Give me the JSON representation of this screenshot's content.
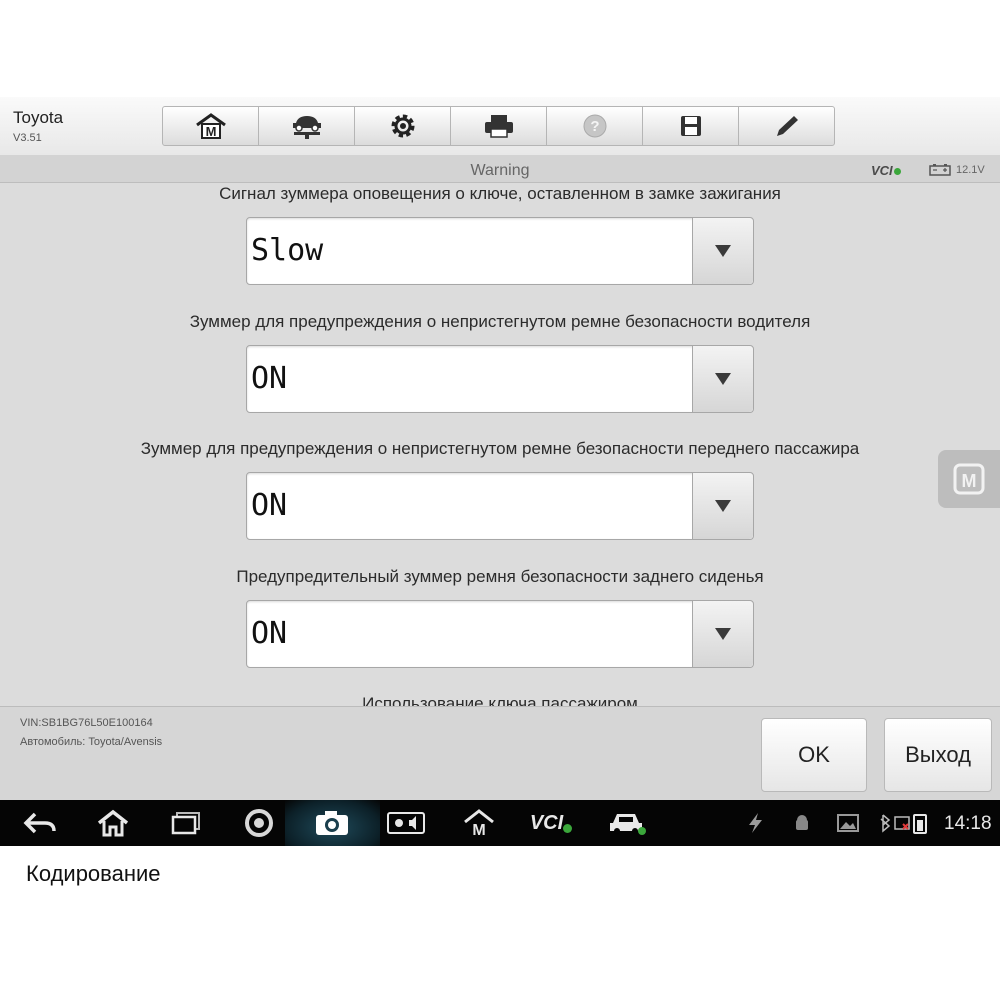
{
  "app": {
    "name": "Toyota",
    "version": "V3.51"
  },
  "toolbar": {
    "items": [
      {
        "icon": "home-m-icon"
      },
      {
        "icon": "car-lift-icon"
      },
      {
        "icon": "gear-icon"
      },
      {
        "icon": "printer-icon"
      },
      {
        "icon": "help-icon"
      },
      {
        "icon": "save-icon"
      },
      {
        "icon": "pen-icon"
      }
    ]
  },
  "titlebar": {
    "title": "Warning",
    "vci": "VCI",
    "battery_voltage": "12.1V"
  },
  "settings": [
    {
      "label": "Сигнал зуммера оповещения о ключе, оставленном в замке зажигания",
      "value": "Slow"
    },
    {
      "label": "Зуммер для предупреждения о непристегнутом ремне безопасности водителя",
      "value": "ON"
    },
    {
      "label": "Зуммер для предупреждения о непристегнутом ремне безопасности переднего пассажира",
      "value": "ON"
    },
    {
      "label": "Предупредительный зуммер ремня безопасности заднего сиденья",
      "value": "ON"
    },
    {
      "label": "Использование ключа пассажиром",
      "value": ""
    }
  ],
  "footer": {
    "vin": "VIN:SB1BG76L50E100164",
    "vehicle": "Автомобиль: Toyota/Avensis",
    "ok_label": "OK",
    "exit_label": "Выход"
  },
  "navbar": {
    "time": "14:18",
    "vci_label": "VCI"
  },
  "caption": "Кодирование",
  "colors": {
    "content_bg": "#dcdcdc",
    "navbar_bg": "#050505",
    "vci_ok": "#3ba73b"
  }
}
